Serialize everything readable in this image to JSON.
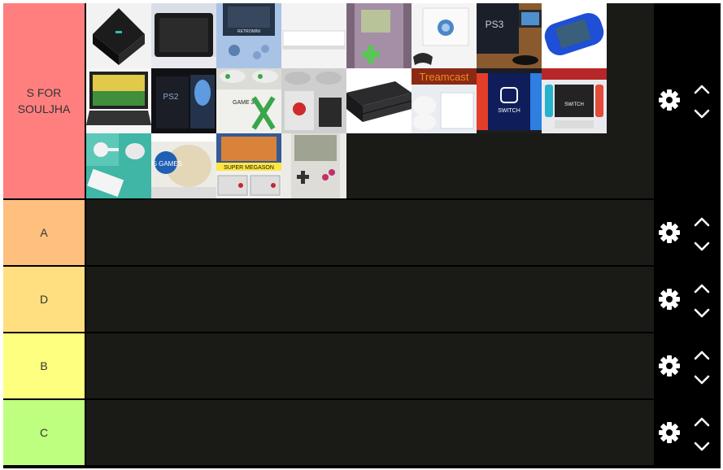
{
  "tiers": [
    {
      "label": "S FOR SOULJHA",
      "color": "#ff7f7f"
    },
    {
      "label": "A",
      "color": "#ffbf7f"
    },
    {
      "label": "D",
      "color": "#ffdf7f"
    },
    {
      "label": "B",
      "color": "#ffff7f"
    },
    {
      "label": "C",
      "color": "#bfff7f"
    }
  ],
  "s_items": [
    {
      "name": "dark-console-tile",
      "caption": ""
    },
    {
      "name": "white-tablet-console-tile",
      "caption": ""
    },
    {
      "name": "retro-handheld-tile",
      "caption": "RETROMINI"
    },
    {
      "name": "white-slim-console-tile",
      "caption": ""
    },
    {
      "name": "purple-handheld-tile",
      "caption": ""
    },
    {
      "name": "white-cube-console-tile",
      "caption": ""
    },
    {
      "name": "ps3-box-tile",
      "caption": "PS3"
    },
    {
      "name": "blue-handheld-tile",
      "caption": ""
    },
    {
      "name": "portable-dvd-tile",
      "caption": ""
    },
    {
      "name": "ps2-console-tile",
      "caption": "PS2"
    },
    {
      "name": "game-3d-x-tile",
      "caption": "GAME 3D"
    },
    {
      "name": "controllers-bundle-tile",
      "caption": ""
    },
    {
      "name": "black-slim-console-tile",
      "caption": ""
    },
    {
      "name": "treamcast-tile",
      "caption": "Treamcast"
    },
    {
      "name": "switch-screen-tile",
      "caption": "SWITCH"
    },
    {
      "name": "switch-console-tile",
      "caption": "SWITCH"
    },
    {
      "name": "teal-console-tile",
      "caption": ""
    },
    {
      "name": "85-games-tile",
      "caption": "85 GAMES"
    },
    {
      "name": "super-megason-tile",
      "caption": "SUPER MEGASON"
    },
    {
      "name": "gameboy-tile",
      "caption": ""
    }
  ]
}
